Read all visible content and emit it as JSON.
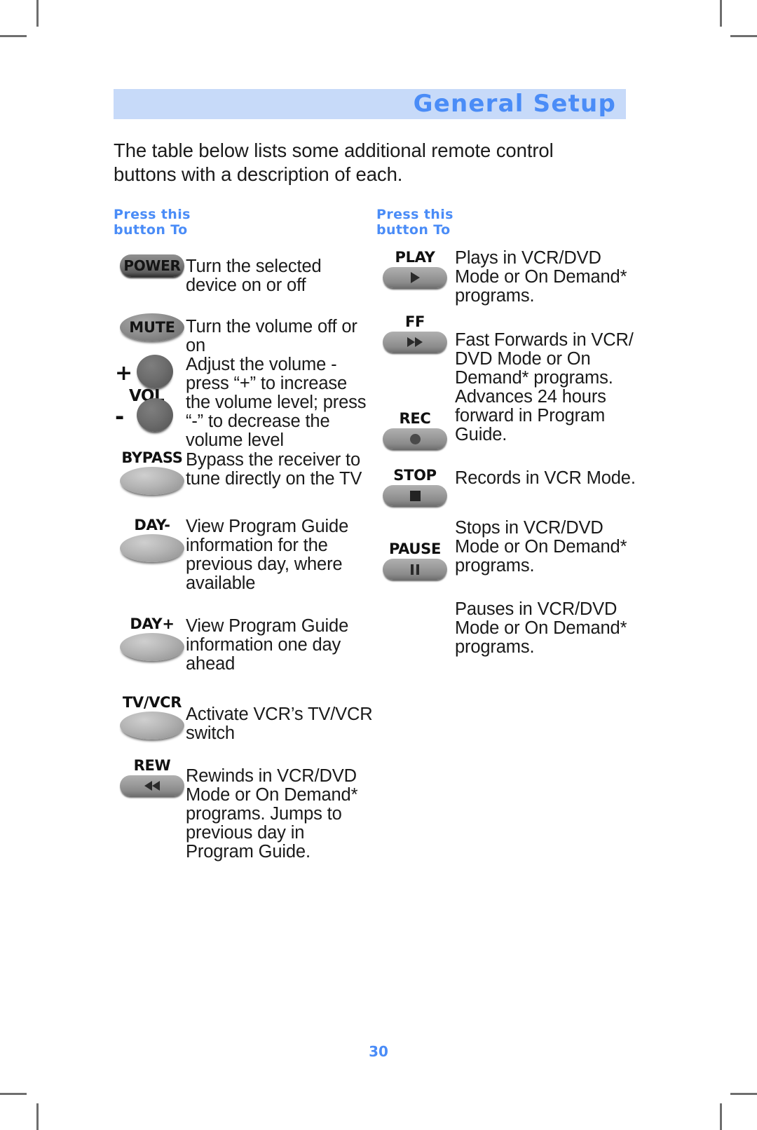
{
  "page": {
    "title": "General Setup",
    "number": "30",
    "intro": "The table below lists some additional remote control buttons with a description of each.",
    "accent_blue": "#4a8cf7",
    "header_band_color": "#c7daf9"
  },
  "columns": [
    {
      "header": "Press this\nbutton To",
      "rows": [
        {
          "button_label": "POWER",
          "button_icon": "power-pill-button",
          "description": "Turn the selected device on or off"
        },
        {
          "button_label": "MUTE",
          "button_icon": "mute-oval-button",
          "description": "Turn the volume off or on"
        },
        {
          "button_label": "VOL",
          "button_icon": "volume-rocker-buttons",
          "plus_sign": "+",
          "minus_sign": "-",
          "description": "Adjust the volume - press “+” to increase the volume level; press “-” to decrease the volume level"
        },
        {
          "button_label": "BYPASS",
          "button_icon": "bypass-oval-button",
          "description": "Bypass the receiver to tune directly on the TV"
        },
        {
          "button_label": "DAY-",
          "button_icon": "day-minus-oval-button",
          "description": "View Program Guide information for the previous day, where available"
        },
        {
          "button_label": "DAY+",
          "button_icon": "day-plus-oval-button",
          "description": "View Program Guide information one day ahead"
        },
        {
          "button_label": "TV/VCR",
          "button_icon": "tv-vcr-oval-button",
          "description": "Activate VCR’s TV/VCR switch"
        },
        {
          "button_label": "REW",
          "button_icon": "rewind-pill-button",
          "description": "Rewinds in VCR/DVD Mode or On Demand* programs.  Jumps to previous day in Program Guide."
        }
      ]
    },
    {
      "header": "Press this\nbutton To",
      "rows": [
        {
          "button_label": "PLAY",
          "button_icon": "play-pill-button",
          "description": "Plays in VCR/DVD Mode or On Demand* programs."
        },
        {
          "button_label": "FF",
          "button_icon": "fast-forward-pill-button",
          "description": "Fast Forwards in VCR/ DVD Mode or On Demand* programs. Advances 24 hours forward in Program Guide."
        },
        {
          "button_label": "REC",
          "button_icon": "record-pill-button",
          "description": "Records in VCR Mode."
        },
        {
          "button_label": "STOP",
          "button_icon": "stop-pill-button",
          "description": "Stops in VCR/DVD Mode or On Demand* programs."
        },
        {
          "button_label": "PAUSE",
          "button_icon": "pause-pill-button",
          "description": "Pauses in VCR/DVD Mode or On Demand* programs."
        }
      ]
    }
  ]
}
